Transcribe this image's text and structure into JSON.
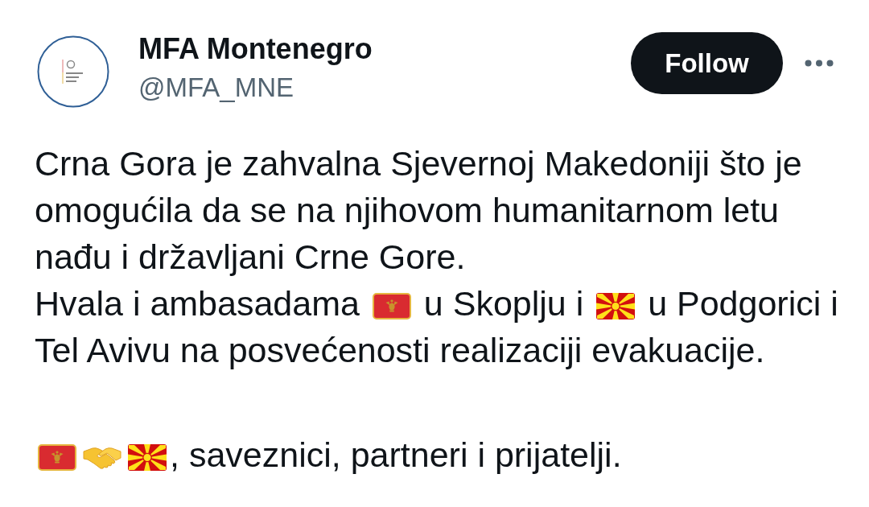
{
  "tweet": {
    "author": {
      "name": "MFA Montenegro",
      "handle": "@MFA_MNE"
    },
    "follow_button": {
      "label": "Follow"
    },
    "paragraphs": [
      {
        "lines": [
          [
            {
              "kind": "text",
              "text": "Crna Gora je zahvalna Sjevernoj Makedoniji što je omogućila da se na njihovom humanitarnom letu nađu i državljani Crne Gore."
            }
          ],
          [
            {
              "kind": "text",
              "text": "Hvala i ambasadama"
            },
            {
              "kind": "montenegro"
            },
            {
              "kind": "text",
              "text": "u Skoplju i"
            },
            {
              "kind": "macedonia"
            },
            {
              "kind": "text",
              "text": "u Podgorici i"
            },
            {
              "kind": "text",
              "text": "Tel Avivu na posvećenosti realizaciji evakuacije."
            }
          ]
        ]
      },
      {
        "lines": [
          [
            {
              "kind": "montenegro"
            },
            {
              "kind": "handshake",
              "joined": true
            },
            {
              "kind": "macedonia",
              "joined": true
            },
            {
              "kind": "text",
              "text": ", saveznici, partneri i prijatelji.",
              "joined": true
            }
          ]
        ]
      }
    ]
  }
}
